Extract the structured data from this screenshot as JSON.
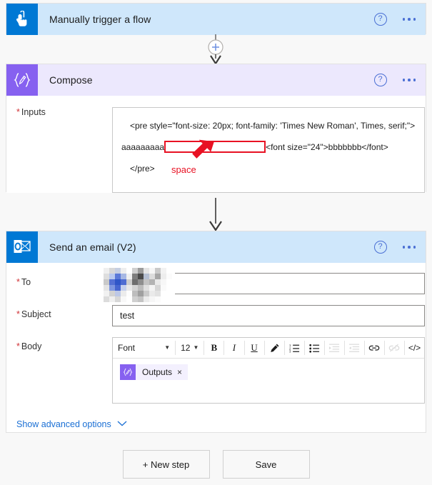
{
  "trigger": {
    "title": "Manually trigger a flow",
    "icon": "hand-tap-icon",
    "help": "?",
    "menu": "more-options"
  },
  "compose": {
    "title": "Compose",
    "icon": "compose-braces-pencil-icon",
    "inputs_label": "Inputs",
    "required_mark": "*",
    "code": {
      "line1": "<pre style=\"font-size: 20px; font-family: 'Times New Roman', Times, serif;\">",
      "line2_before": "aaaaaaaaa",
      "line2_after": "<font size=\"24\">bbbbbbb</font>",
      "line3": "</pre>"
    },
    "annotation": {
      "label": "space",
      "color": "#e81123"
    }
  },
  "email": {
    "title": "Send an email (V2)",
    "icon": "outlook-icon",
    "to": {
      "label": "To",
      "value": "",
      "redacted": true
    },
    "subject": {
      "label": "Subject",
      "value": "test"
    },
    "body": {
      "label": "Body",
      "toolbar": {
        "font_name": "Font",
        "font_size": "12",
        "bold": "B",
        "italic": "I",
        "underline": "U",
        "text_color": "pen-icon",
        "numbered_list": "numbered-list-icon",
        "bulleted_list": "bulleted-list-icon",
        "indent_increase": "indent-increase-icon",
        "indent_decrease": "indent-decrease-icon",
        "link": "link-icon",
        "unlink": "unlink-icon",
        "code_view": "</>"
      },
      "token": {
        "label": "Outputs",
        "remove": "×"
      }
    },
    "advanced_options": {
      "label": "Show advanced options",
      "chevron": "⌄"
    }
  },
  "footer": {
    "new_step": "+ New step",
    "save": "Save"
  },
  "colors": {
    "trigger_header": "#cfe7fb",
    "compose_header": "#ece8fd",
    "accent_blue": "#0078d4",
    "accent_purple": "#8661f0",
    "required_red": "#d13438",
    "annotation_red": "#e81123",
    "link_blue": "#1a6fd4"
  }
}
